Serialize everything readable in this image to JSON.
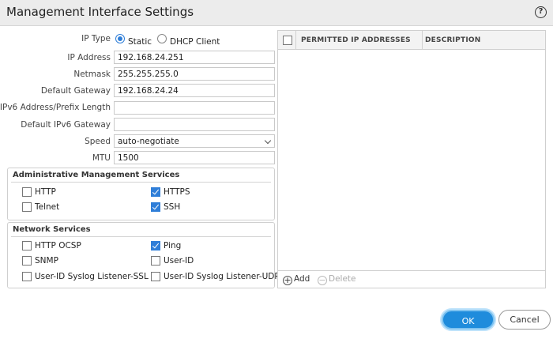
{
  "dialog": {
    "title": "Management Interface Settings",
    "help_icon": "?"
  },
  "form": {
    "ip_type": {
      "label": "IP Type",
      "options": [
        "Static",
        "DHCP Client"
      ],
      "selected": "Static"
    },
    "ip_address": {
      "label": "IP Address",
      "value": "192.168.24.251"
    },
    "netmask": {
      "label": "Netmask",
      "value": "255.255.255.0"
    },
    "default_gateway": {
      "label": "Default Gateway",
      "value": "192.168.24.24"
    },
    "ipv6_address": {
      "label": "IPv6 Address/Prefix Length",
      "value": ""
    },
    "default_ipv6_gateway": {
      "label": "Default IPv6 Gateway",
      "value": ""
    },
    "speed": {
      "label": "Speed",
      "value": "auto-negotiate"
    },
    "mtu": {
      "label": "MTU",
      "value": "1500"
    }
  },
  "admin_services": {
    "title": "Administrative Management Services",
    "items": [
      {
        "label": "HTTP",
        "checked": false
      },
      {
        "label": "HTTPS",
        "checked": true
      },
      {
        "label": "Telnet",
        "checked": false
      },
      {
        "label": "SSH",
        "checked": true
      }
    ]
  },
  "network_services": {
    "title": "Network Services",
    "items": [
      {
        "label": "HTTP OCSP",
        "checked": false
      },
      {
        "label": "Ping",
        "checked": true
      },
      {
        "label": "SNMP",
        "checked": false
      },
      {
        "label": "User-ID",
        "checked": false
      },
      {
        "label": "User-ID Syslog Listener-SSL",
        "checked": false
      },
      {
        "label": "User-ID Syslog Listener-UDP",
        "checked": false
      }
    ]
  },
  "permitted_ips": {
    "columns": [
      "PERMITTED IP ADDRESSES",
      "DESCRIPTION"
    ],
    "rows": [],
    "add_label": "Add",
    "delete_label": "Delete"
  },
  "buttons": {
    "ok": "OK",
    "cancel": "Cancel"
  },
  "colors": {
    "accent": "#2f7ed8",
    "ok_button": "#1f8cdc"
  }
}
